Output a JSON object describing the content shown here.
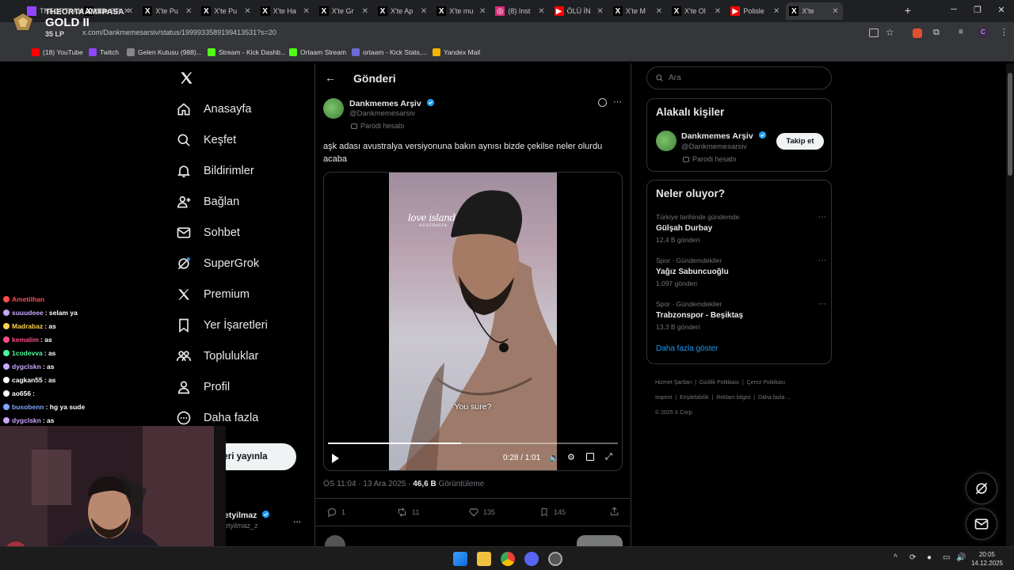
{
  "browser": {
    "tabs": [
      {
        "label": "THEORTAAM#PASA",
        "fav": "twitch"
      },
      {
        "label": "X'te BP",
        "fav": "x"
      },
      {
        "label": "X'te Pu",
        "fav": "x"
      },
      {
        "label": "X'te Pu",
        "fav": "x"
      },
      {
        "label": "X'te Ha",
        "fav": "x"
      },
      {
        "label": "X'te Gr",
        "fav": "x"
      },
      {
        "label": "X'te Ap",
        "fav": "x"
      },
      {
        "label": "X'te mu",
        "fav": "x"
      },
      {
        "label": "(8) Inst",
        "fav": "instagram"
      },
      {
        "label": "ÖLÜ İN",
        "fav": "youtube"
      },
      {
        "label": "X'te M",
        "fav": "x"
      },
      {
        "label": "X'te Ol",
        "fav": "x"
      },
      {
        "label": "Polisle",
        "fav": "youtube"
      },
      {
        "label": "X'te",
        "fav": "x"
      }
    ],
    "new_tab": "+",
    "url": "x.com/Dankmemesarsiv/status/1999933589199413531?s=20",
    "bookmarks": [
      "(18) YouTube",
      "Twitch",
      "Gelen Kutusu (988)...",
      "Stream - Kick Dashb...",
      "Ortaam Stream",
      "ortaam - Kick Stats,...",
      "Yandex Mail"
    ]
  },
  "overlay": {
    "player": "THEORTAAM#PASA",
    "tier": "GOLD II",
    "lp": "35 LP",
    "chat": [
      {
        "user": "Ametilhan",
        "msg": "",
        "color": "#ff4d4d"
      },
      {
        "user": "suuudeee",
        "msg": ": selam ya",
        "color": "#c9a7ff"
      },
      {
        "user": "Madrabaz",
        "msg": ": as",
        "color": "#ffd24d"
      },
      {
        "user": "kemalim",
        "msg": ": as",
        "color": "#ff4d8a"
      },
      {
        "user": "1codevva",
        "msg": ": as",
        "color": "#4dff9a"
      },
      {
        "user": "dygclskn",
        "msg": ": as",
        "color": "#c9a7ff"
      },
      {
        "user": "cagkan55",
        "msg": ": as",
        "color": "#ffffff"
      },
      {
        "user": "ao656",
        "msg": ":",
        "color": "#ffffff"
      },
      {
        "user": "busobenn",
        "msg": ": hg ya sude",
        "color": "#7fa8ff"
      },
      {
        "user": "dygclskn",
        "msg": ": as",
        "color": "#c9a7ff"
      }
    ]
  },
  "nav": {
    "items": [
      "Anasayfa",
      "Keşfet",
      "Bildirimler",
      "Bağlan",
      "Sohbet",
      "SuperGrok",
      "Premium",
      "Yer İşaretleri",
      "Topluluklar",
      "Profil",
      "Daha fazla"
    ],
    "post_button": "eri yayınla",
    "account_name": "etyilmaz",
    "account_handle": "etyilmaz_z",
    "more": "..."
  },
  "post": {
    "header_title": "Gönderi",
    "author_name": "Dankmemes Arşiv",
    "author_handle": "@Dankmemesarsiv",
    "author_label": "Parodi hesabı",
    "text": "aşk adası avustralya versiyonuna bakın aynısı bizde çekilse neler olurdu acaba",
    "video": {
      "caption": "You sure?",
      "logo": "love island",
      "logo_sub": "AUSTRALIA",
      "time": "0:28 / 1:01",
      "progress": 0.46
    },
    "meta_time": "ÖS 11:04 · 13 Ara 2025 · ",
    "views": "46,6 B",
    "views_label": " Görüntüleme",
    "actions": {
      "replies": "1",
      "reposts": "11",
      "likes": "135",
      "bookmarks": "145"
    }
  },
  "sidebar": {
    "search_placeholder": "Ara",
    "related_title": "Alakalı kişiler",
    "related_name": "Dankmemes Arşiv",
    "related_handle": "@Dankmemesarsiv",
    "related_label": "Parodi hesabı",
    "follow_label": "Takip et",
    "trends_title": "Neler oluyor?",
    "trends": [
      {
        "meta": "Türkiye tarihinde gündemde",
        "name": "Gülşah Durbay",
        "count": "12,4 B gönderi"
      },
      {
        "meta": "Spor · Gündemdekiler",
        "name": "Yağız Sabuncuoğlu",
        "count": "1.097 gönderi"
      },
      {
        "meta": "Spor · Gündemdekiler",
        "name": "Trabzonspor - Beşiktaş",
        "count": "13,3 B gönderi"
      }
    ],
    "show_more": "Daha fazla göster",
    "footer": [
      "Hizmet Şartları",
      "Gizlilik Politikası",
      "Çerez Politikası",
      "Imprint",
      "Erişilebilirlik",
      "Reklam bilgisi",
      "Daha fazla ...",
      "© 2025 X Corp."
    ]
  },
  "taskbar": {
    "time": "20:05",
    "date": "14.12.2025"
  },
  "colors": {
    "accent": "#1d9bf0",
    "bg": "#000000",
    "border": "#2f3336",
    "muted": "#71767b"
  }
}
